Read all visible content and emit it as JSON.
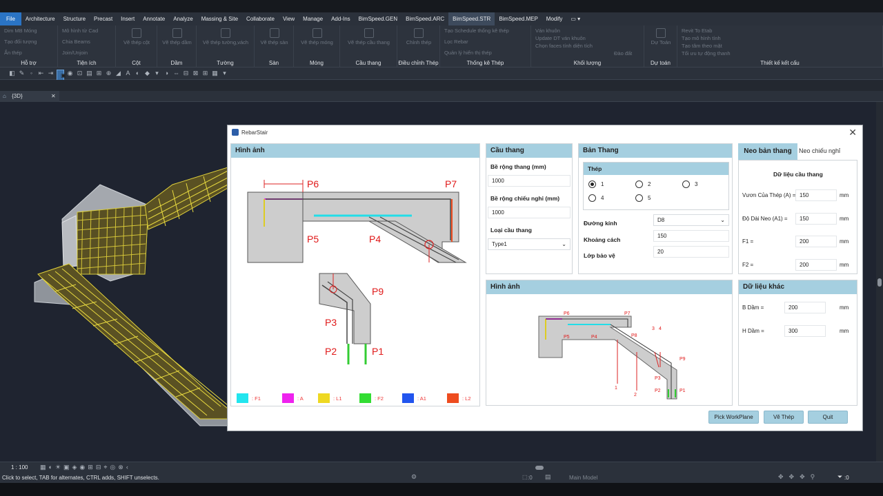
{
  "menu": {
    "items": [
      "File",
      "Architecture",
      "Structure",
      "Precast",
      "Insert",
      "Annotate",
      "Analyze",
      "Massing & Site",
      "Collaborate",
      "View",
      "Manage",
      "Add-Ins",
      "BimSpeed.GEN",
      "BimSpeed.ARC",
      "BimSpeed.STR",
      "BimSpeed.MEP",
      "Modify"
    ],
    "active": "BimSpeed.STR"
  },
  "ribbon": {
    "groups": [
      {
        "label": "Hỗ trợ",
        "buttons": [
          "Dim MB Móng",
          "Tạo đối tượng",
          "Ẩn thép"
        ]
      },
      {
        "label": "Tiện ích",
        "buttons": [
          "Mô hình từ Cad",
          "Chia Beams",
          "Join/Unjoin"
        ]
      },
      {
        "label": "Cột",
        "buttons": [
          "Vẽ thép cột"
        ]
      },
      {
        "label": "Dầm",
        "buttons": [
          "Vẽ thép dầm"
        ]
      },
      {
        "label": "Tường",
        "buttons": [
          "Vẽ thép tường,vách"
        ]
      },
      {
        "label": "Sàn",
        "buttons": [
          "Vẽ thép sàn"
        ]
      },
      {
        "label": "Móng",
        "buttons": [
          "Vẽ thép móng"
        ]
      },
      {
        "label": "Cầu thang",
        "buttons": [
          "Vẽ thép cầu thang"
        ]
      },
      {
        "label": "Điều chỉnh Thép",
        "buttons": [
          "Chỉnh thép"
        ]
      },
      {
        "label": "Thống kê Thép",
        "buttons": [
          "Tạo Schedule thống kê thép",
          "Lọc Rebar",
          "Quản lý hiển thị thép"
        ]
      },
      {
        "label": "Khối lượng",
        "buttons": [
          "Ván khuôn",
          "Update DT ván khuôn",
          "Chọn faces tính diện tích",
          "Đào đất"
        ]
      },
      {
        "label": "Dự toán",
        "buttons": [
          "Dự Toán"
        ]
      },
      {
        "label": "Thiết kế kết cấu",
        "buttons": [
          "Revit To Etab",
          "Tạo mô hình tính",
          "Tạo tâm theo mặt",
          "Tối ưu tự động thanh"
        ]
      }
    ]
  },
  "view_tab": {
    "label": "{3D}"
  },
  "status": {
    "scale": "1 : 100",
    "message": "Click to select, TAB for alternates, CTRL adds, SHIFT unselects.",
    "model": "Main Model",
    "sel_count": ":0",
    "filter_count": ":0"
  },
  "dialog": {
    "title": "RebarStair",
    "image_panel_title": "Hình ảnh",
    "points": {
      "p1": "P1",
      "p2": "P2",
      "p3": "P3",
      "p4": "P4",
      "p5": "P5",
      "p6": "P6",
      "p7": "P7",
      "p8": "P8",
      "p9": "P9",
      "n1": "1",
      "n2": "2",
      "n3": "3",
      "n4": "4"
    },
    "legend": [
      {
        "color": "#22e5ee",
        "label": ": F1"
      },
      {
        "color": "#ee22ee",
        "label": ": A"
      },
      {
        "color": "#eed822",
        "label": ": L1"
      },
      {
        "color": "#33dd33",
        "label": ": F2"
      },
      {
        "color": "#2255ee",
        "label": ": A1"
      },
      {
        "color": "#ee4c1f",
        "label": ": L2"
      }
    ],
    "cau_thang": {
      "title": "Cầu thang",
      "width_label": "Bề rộng thang (mm)",
      "width_value": "1000",
      "landing_label": "Bề rộng chiếu nghỉ (mm)",
      "landing_value": "1000",
      "type_label": "Loại cầu thang",
      "type_value": "Type1"
    },
    "ban_thang": {
      "title": "Bản Thang",
      "thep_title": "Thép",
      "options": [
        "1",
        "2",
        "3",
        "4",
        "5"
      ],
      "selected": "1",
      "diameter_label": "Đường kính",
      "diameter_value": "D8",
      "spacing_label": "Khoảng cách",
      "spacing_value": "150",
      "cover_label": "Lớp bảo vệ",
      "cover_value": "20"
    },
    "tabs": {
      "active": "Neo bản thang",
      "other": "Neo chiếu nghỉ"
    },
    "stair_data": {
      "title": "Dữ liệu cầu thang",
      "rows": [
        {
          "label": "Vươn Của Thép (A) =",
          "value": "150",
          "unit": "mm"
        },
        {
          "label": "Độ Dài Neo (A1) =",
          "value": "150",
          "unit": "mm"
        },
        {
          "label": "F1 =",
          "value": "200",
          "unit": "mm"
        },
        {
          "label": "F2 =",
          "value": "200",
          "unit": "mm"
        }
      ]
    },
    "image2_title": "Hình ảnh",
    "other_data": {
      "title": "Dữ liệu khác",
      "rows": [
        {
          "label": "B Dầm =",
          "value": "200",
          "unit": "mm"
        },
        {
          "label": "H Dầm =",
          "value": "300",
          "unit": "mm"
        }
      ]
    },
    "buttons": {
      "pick": "Pick WorkPlane",
      "draw": "Vẽ Thép",
      "quit": "Quit"
    }
  }
}
